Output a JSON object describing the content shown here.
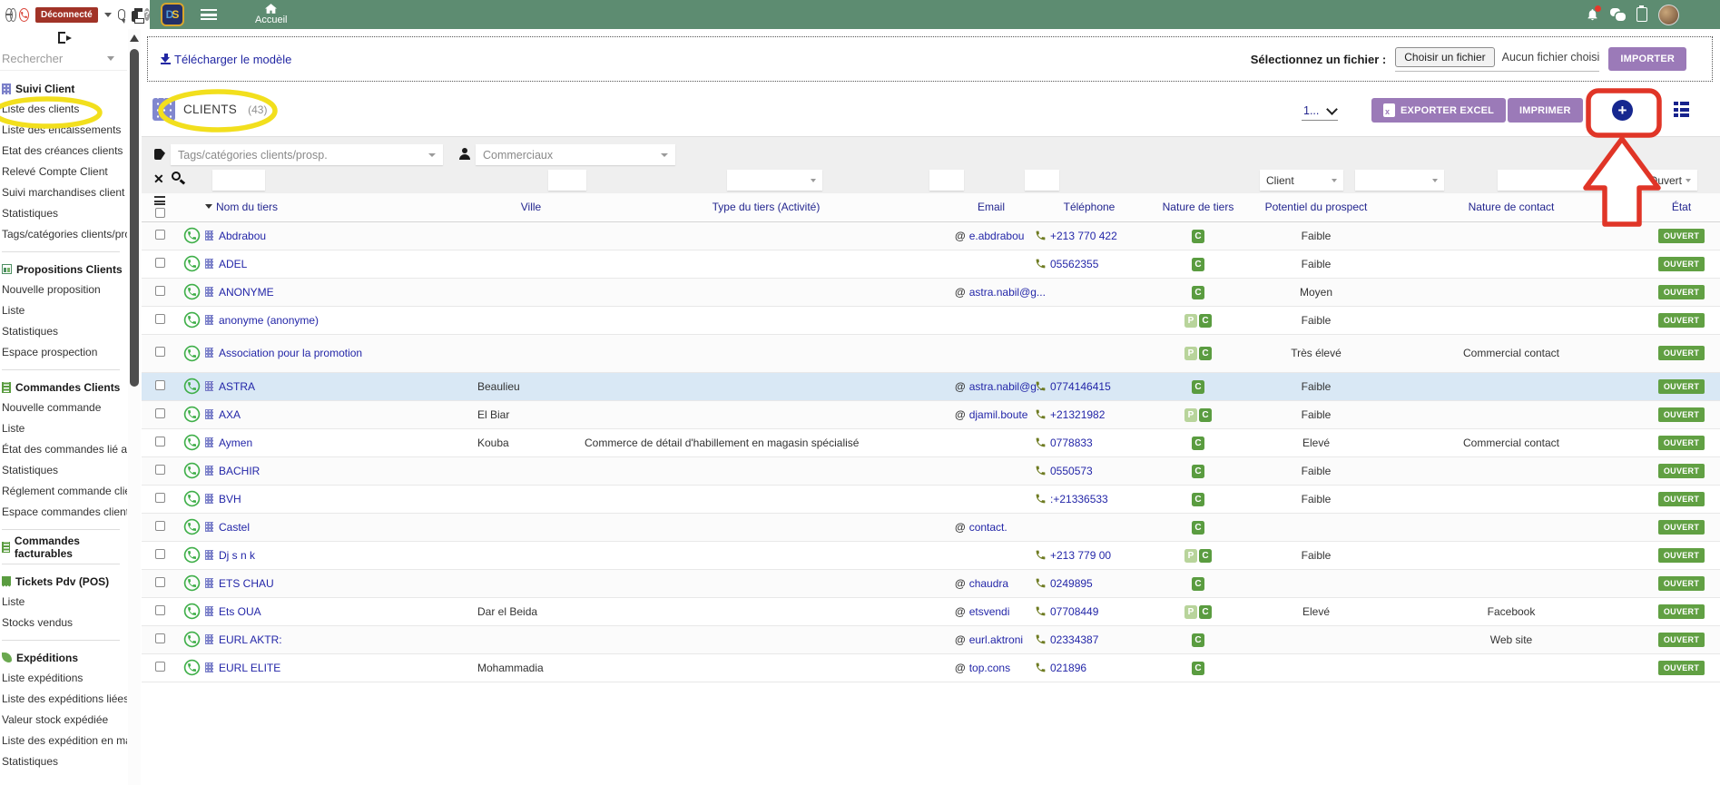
{
  "topbar": {
    "disconnected_label": "Déconnecté",
    "search_placeholder": "Rechercher",
    "logo_d": "D",
    "logo_s": "S",
    "home_label": "Accueil"
  },
  "sidebar": {
    "sections": [
      {
        "title": "Suivi Client",
        "icon": "building-icon",
        "items": [
          "Liste des clients",
          "Liste des encaissements",
          "Etat des créances clients",
          "Relevé Compte Client",
          "Suivi marchandises client",
          "Statistiques",
          "Tags/catégories clients/prosp."
        ]
      },
      {
        "title": "Propositions Clients",
        "icon": "chart-icon",
        "items": [
          "Nouvelle proposition",
          "Liste",
          "Statistiques",
          "Espace prospection"
        ]
      },
      {
        "title": "Commandes Clients",
        "icon": "document-icon",
        "items": [
          "Nouvelle commande",
          "Liste",
          "État des commandes lié aux ...",
          "Statistiques",
          "Réglement commande client",
          "Espace commandes clients"
        ]
      },
      {
        "title": "Commandes facturables",
        "icon": "document-icon",
        "items": []
      },
      {
        "title": "Tickets Pdv (POS)",
        "icon": "receipt-icon",
        "items": [
          "Liste",
          "Stocks vendus"
        ]
      },
      {
        "title": "Expéditions",
        "icon": "shipment-icon",
        "items": [
          "Liste expéditions",
          "Liste des expéditions liées au...",
          "Valeur stock expédiée",
          "Liste des expédition en map",
          "Statistiques"
        ]
      }
    ]
  },
  "import_bar": {
    "download_label": "Télécharger le modèle",
    "select_label": "Sélectionnez un fichier :",
    "choose_button": "Choisir un fichier",
    "no_file_text": "Aucun fichier choisi",
    "import_button": "IMPORTER"
  },
  "toolbar": {
    "title": "CLIENTS",
    "count": "(43)",
    "pagination": "1...",
    "export_button": "EXPORTER EXCEL",
    "export_icon_letter": "x",
    "print_button": "IMPRIMER",
    "add_button": "+"
  },
  "filters": {
    "tags_placeholder": "Tags/catégories clients/prosp.",
    "commercials_placeholder": "Commerciaux",
    "nature_filter_value": "Client",
    "state_filter_value": "Ouvert",
    "clear_icon": "✕"
  },
  "table": {
    "columns": [
      "Nom du tiers",
      "Ville",
      "Type du tiers (Activité)",
      "Email",
      "Téléphone",
      "Nature de tiers",
      "Potentiel du prospect",
      "Nature de contact",
      "État"
    ],
    "rows": [
      {
        "name": "Abdrabou",
        "ville": "",
        "activity": "",
        "email": "e.abdrabou",
        "phone": "+213 770 422",
        "nature": [
          "C"
        ],
        "potentiel": "Faible",
        "contact": "",
        "etat": "OUVERT"
      },
      {
        "name": "ADEL",
        "ville": "",
        "activity": "",
        "email": "",
        "phone": "05562355",
        "nature": [
          "C"
        ],
        "potentiel": "Faible",
        "contact": "",
        "etat": "OUVERT"
      },
      {
        "name": "ANONYME",
        "ville": "",
        "activity": "",
        "email": "astra.nabil@g...",
        "phone": "",
        "nature": [
          "C"
        ],
        "potentiel": "Moyen",
        "contact": "",
        "etat": "OUVERT"
      },
      {
        "name": "anonyme (anonyme)",
        "ville": "",
        "activity": "",
        "email": "",
        "phone": "",
        "nature": [
          "P",
          "C"
        ],
        "potentiel": "Faible",
        "contact": "",
        "etat": "OUVERT"
      },
      {
        "name": "Association pour la promotion",
        "ville": "",
        "activity": "",
        "email": "",
        "phone": "",
        "nature": [
          "P",
          "C"
        ],
        "potentiel": "Très élevé",
        "contact": "Commercial contact",
        "etat": "OUVERT",
        "tall": true
      },
      {
        "name": "ASTRA",
        "ville": "Beaulieu",
        "activity": "",
        "email": "astra.nabil@g...",
        "phone": "0774146415",
        "nature": [
          "C"
        ],
        "potentiel": "Faible",
        "contact": "",
        "etat": "OUVERT",
        "highlight": true
      },
      {
        "name": "AXA",
        "ville": "El Biar",
        "activity": "",
        "email": "djamil.boute",
        "phone": "+21321982",
        "nature": [
          "P",
          "C"
        ],
        "potentiel": "Faible",
        "contact": "",
        "etat": "OUVERT"
      },
      {
        "name": "Aymen",
        "ville": "Kouba",
        "activity": "Commerce de détail d'habillement en magasin spécialisé",
        "email": "",
        "phone": "0778833",
        "nature": [
          "C"
        ],
        "potentiel": "Elevé",
        "contact": "Commercial contact",
        "etat": "OUVERT"
      },
      {
        "name": "BACHIR",
        "ville": "",
        "activity": "",
        "email": "",
        "phone": "0550573",
        "nature": [
          "C"
        ],
        "potentiel": "Faible",
        "contact": "",
        "etat": "OUVERT"
      },
      {
        "name": "BVH",
        "ville": "",
        "activity": "",
        "email": "",
        "phone": ":+21336533",
        "nature": [
          "C"
        ],
        "potentiel": "Faible",
        "contact": "",
        "etat": "OUVERT"
      },
      {
        "name": "Castel",
        "ville": "",
        "activity": "",
        "email": "contact.",
        "phone": "",
        "nature": [
          "C"
        ],
        "potentiel": "",
        "contact": "",
        "etat": "OUVERT"
      },
      {
        "name": "Dj s n k",
        "ville": "",
        "activity": "",
        "email": "",
        "phone": "+213 779 00",
        "nature": [
          "P",
          "C"
        ],
        "potentiel": "Faible",
        "contact": "",
        "etat": "OUVERT"
      },
      {
        "name": "ETS CHAU",
        "ville": "",
        "activity": "",
        "email": "chaudra",
        "phone": "0249895",
        "nature": [
          "C"
        ],
        "potentiel": "",
        "contact": "",
        "etat": "OUVERT"
      },
      {
        "name": "Ets OUA",
        "ville": "Dar el Beida",
        "activity": "",
        "email": "etsvendi",
        "phone": "07708449",
        "nature": [
          "P",
          "C"
        ],
        "potentiel": "Elevé",
        "contact": "Facebook",
        "etat": "OUVERT"
      },
      {
        "name": "EURL AKTR:",
        "ville": "",
        "activity": "",
        "email": "eurl.aktroni",
        "phone": "02334387",
        "nature": [
          "C"
        ],
        "potentiel": "",
        "contact": "Web site",
        "etat": "OUVERT"
      },
      {
        "name": "EURL ELITE",
        "ville": "Mohammadia",
        "activity": "",
        "email": "top.cons",
        "phone": "021896",
        "nature": [
          "C"
        ],
        "potentiel": "",
        "contact": "",
        "etat": "OUVERT"
      }
    ]
  },
  "colors": {
    "header_green": "#5d8c71",
    "button_purple": "#9b7ab8",
    "link_navy": "#2326a8",
    "badge_green": "#5a9c40",
    "badge_light_green": "#b8d49b",
    "open_badge_green": "#61a043",
    "annotation_red": "#e03527",
    "annotation_yellow": "#f2df1d",
    "highlight_row": "#d9e8f5"
  }
}
